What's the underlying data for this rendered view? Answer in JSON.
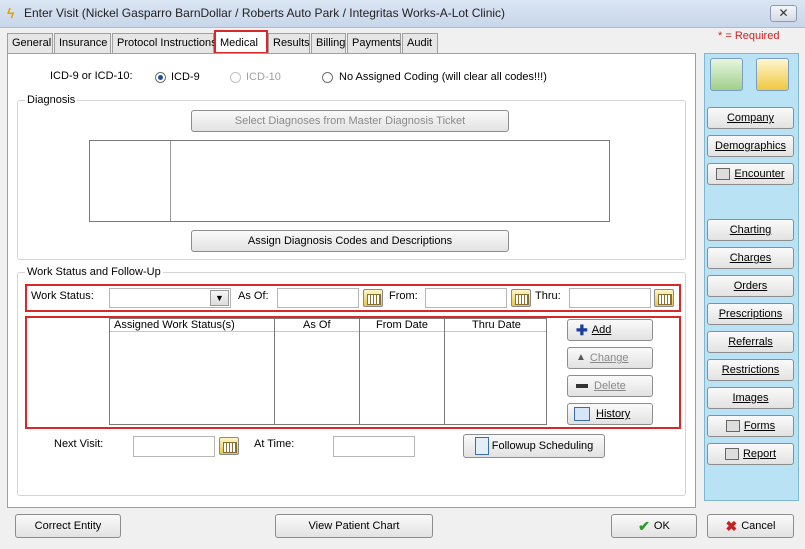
{
  "window": {
    "title": "Enter Visit (Nickel Gasparro BarnDollar / Roberts Auto Park / Integritas Works-A-Lot Clinic)",
    "close": "✕"
  },
  "tabs": [
    "General",
    "Insurance",
    "Protocol Instructions",
    "Medical",
    "Results",
    "Billing",
    "Payments",
    "Audit"
  ],
  "active_tab": "Medical",
  "required_note": "* = Required",
  "coding": {
    "label": "ICD-9 or ICD-10:",
    "options": [
      "ICD-9",
      "ICD-10",
      "No Assigned Coding (will clear all codes!!!)"
    ],
    "selected": "ICD-9"
  },
  "diagnosis": {
    "label": "Diagnosis",
    "select_button": "Select Diagnoses from Master Diagnosis Ticket",
    "assign_button": "Assign Diagnosis Codes and Descriptions"
  },
  "work": {
    "label": "Work Status and Follow-Up",
    "work_status_label": "Work Status:",
    "as_of_label": "As Of:",
    "from_label": "From:",
    "thru_label": "Thru:",
    "columns": [
      "Assigned Work Status(s)",
      "As Of",
      "From Date",
      "Thru Date"
    ],
    "buttons": {
      "add": "Add",
      "change": "Change",
      "delete": "Delete",
      "history": "History"
    },
    "next_visit_label": "Next Visit:",
    "at_time_label": "At Time:",
    "followup_button": "Followup Scheduling"
  },
  "sidebar": [
    "Company",
    "Demographics",
    "Encounter",
    "Charting",
    "Charges",
    "Orders",
    "Prescriptions",
    "Referrals",
    "Restrictions",
    "Images",
    "Forms",
    "Report"
  ],
  "footer": {
    "correct_entity": "Correct Entity",
    "view_chart": "View Patient Chart",
    "ok": "OK",
    "cancel": "Cancel"
  },
  "colors": {
    "highlight": "#d8282a",
    "sidebar_bg": "#b9e3f5",
    "required": "#d42020"
  }
}
